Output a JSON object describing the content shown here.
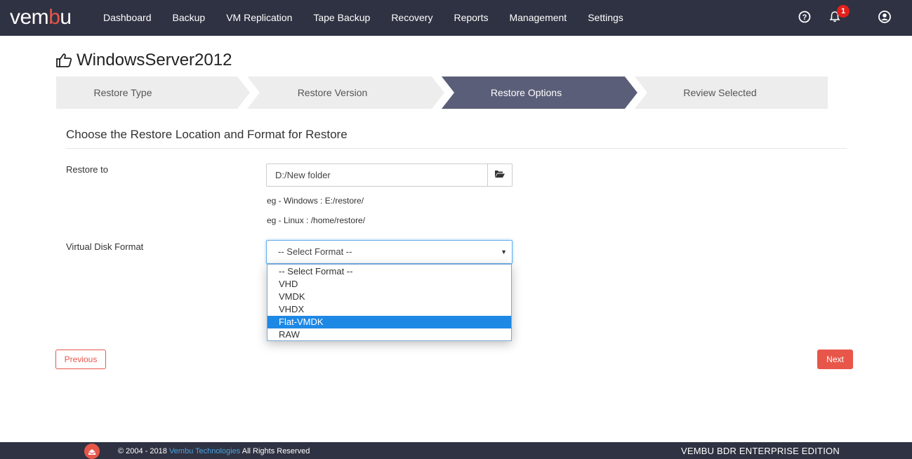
{
  "brand": {
    "logo_prefix": "vem",
    "logo_accent": "b",
    "logo_suffix": "u"
  },
  "nav": {
    "items": [
      "Dashboard",
      "Backup",
      "VM Replication",
      "Tape Backup",
      "Recovery",
      "Reports",
      "Management",
      "Settings"
    ],
    "icons": [
      "help-icon",
      "bell-icon",
      "user-icon"
    ],
    "notification_count": "1"
  },
  "page": {
    "title": "WindowsServer2012",
    "title_icon": "thumbs-up-icon"
  },
  "steps": [
    {
      "label": "Restore Type",
      "active": false
    },
    {
      "label": "Restore Version",
      "active": false
    },
    {
      "label": "Restore Options",
      "active": true
    },
    {
      "label": "Review Selected",
      "active": false
    }
  ],
  "form": {
    "section_title": "Choose the Restore Location and Format for Restore",
    "restore_to_label": "Restore to",
    "restore_to_value": "D:/New folder",
    "hint_windows": "eg - Windows : E:/restore/",
    "hint_linux": "eg - Linux : /home/restore/",
    "disk_format_label": "Virtual Disk Format",
    "disk_format_selected": "-- Select Format --",
    "disk_format_options": [
      "-- Select Format --",
      "VHD",
      "VMDK",
      "VHDX",
      "Flat-VMDK",
      "RAW"
    ],
    "highlighted_option": "Flat-VMDK"
  },
  "buttons": {
    "previous": "Previous",
    "next": "Next"
  },
  "footer": {
    "copyright_prefix": "© 2004 - 2018",
    "company_link": "Vembu Technologies",
    "rights": "All Rights Reserved",
    "edition": "VEMBU BDR ENTERPRISE EDITION"
  },
  "colors": {
    "navbar": "#2f3242",
    "accent": "#e8564a",
    "active_step": "#5b5e78",
    "inactive_step": "#ededed",
    "highlight": "#1e88e5",
    "link": "#4aa3df"
  }
}
